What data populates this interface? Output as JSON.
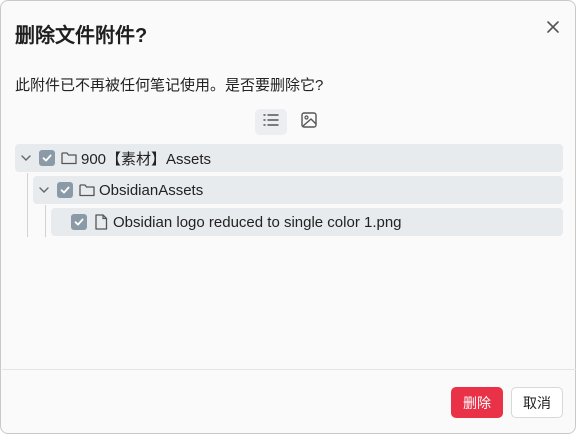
{
  "dialog": {
    "title": "删除文件附件?",
    "message": "此附件已不再被任何笔记使用。是否要删除它?",
    "close_icon": "close-icon"
  },
  "view_toggle": {
    "list_icon": "list-icon",
    "image_icon": "image-icon",
    "active": "list"
  },
  "tree": [
    {
      "label": "900【素材】Assets",
      "type": "folder",
      "checked": true,
      "expanded": true,
      "level": 0
    },
    {
      "label": "ObsidianAssets",
      "type": "folder",
      "checked": true,
      "expanded": true,
      "level": 1
    },
    {
      "label": "Obsidian logo reduced to single color 1.png",
      "type": "file",
      "checked": true,
      "level": 2
    }
  ],
  "buttons": {
    "delete": "删除",
    "cancel": "取消"
  },
  "colors": {
    "delete_button": "#e93147",
    "checkbox": "#8a9aa7",
    "row_background": "#e8ebee"
  }
}
